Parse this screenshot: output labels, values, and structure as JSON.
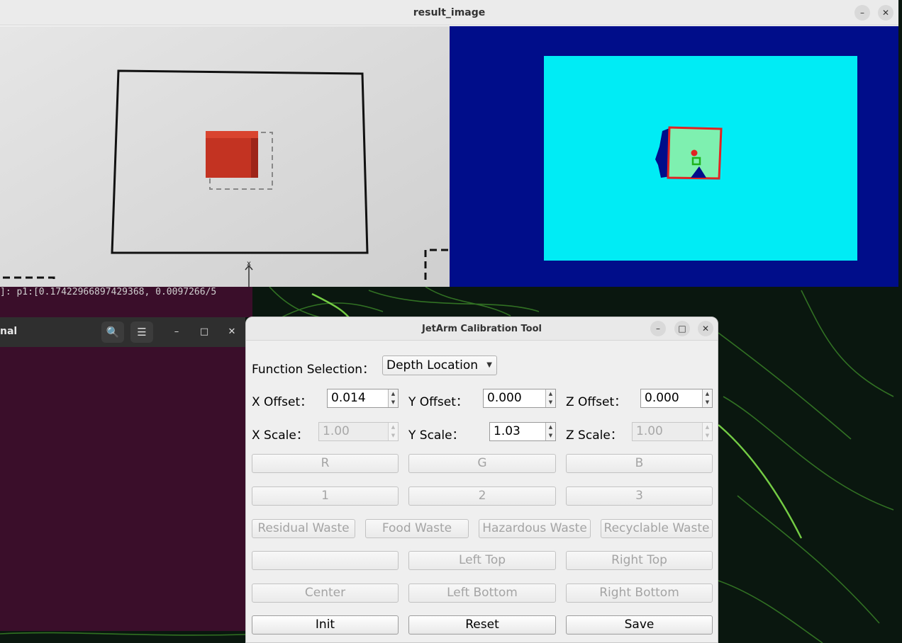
{
  "result_window": {
    "title": "result_image",
    "minimize_label": "–",
    "close_label": "✕"
  },
  "terminal": {
    "title": "nal",
    "log_text": "]: p1:[0.17422966897429368, 0.0097266/5",
    "minimize_label": "–",
    "maximize_label": "□",
    "close_label": "✕",
    "search_label": "🔍",
    "menu_label": "☰"
  },
  "calibration_tool": {
    "title": "JetArm Calibration Tool",
    "window_controls": {
      "minimize": "–",
      "maximize": "□",
      "close": "✕"
    },
    "function_selection": {
      "label": "Function Selection：",
      "value": "Depth Location"
    },
    "offsets": {
      "x": {
        "label": "X Offset：",
        "value": "0.014"
      },
      "y": {
        "label": "Y Offset：",
        "value": "0.000"
      },
      "z": {
        "label": "Z Offset：",
        "value": "0.000"
      }
    },
    "scales": {
      "x": {
        "label": "X Scale：",
        "value": "1.00"
      },
      "y": {
        "label": "Y Scale：",
        "value": "1.03"
      },
      "z": {
        "label": "Z Scale：",
        "value": "1.00"
      }
    },
    "color_buttons": [
      "R",
      "G",
      "B"
    ],
    "number_buttons": [
      "1",
      "2",
      "3"
    ],
    "waste_buttons": [
      "Residual Waste",
      "Food Waste",
      "Hazardous Waste",
      "Recyclable Waste"
    ],
    "position_row1": [
      "",
      "Left Top",
      "Right Top"
    ],
    "position_row2": [
      "Center",
      "Left Bottom",
      "Right Bottom"
    ],
    "actions": {
      "init": "Init",
      "reset": "Reset",
      "save": "Save"
    }
  },
  "camera_view": {
    "axis_label": "x"
  }
}
